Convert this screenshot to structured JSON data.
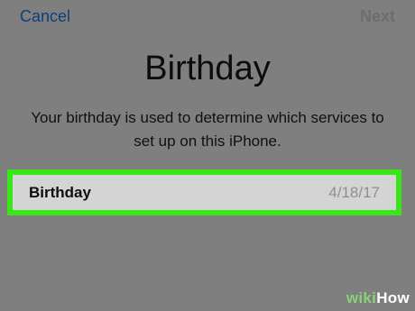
{
  "nav": {
    "cancel_label": "Cancel",
    "next_label": "Next"
  },
  "header": {
    "title": "Birthday",
    "subtitle": "Your birthday is used to determine which services to set up on this iPhone."
  },
  "birthday_field": {
    "label": "Birthday",
    "value": "4/18/17"
  },
  "watermark": {
    "part1": "wiki",
    "part2": "How"
  },
  "colors": {
    "background": "#7f7f7f",
    "accent_link": "#0e3f7a",
    "highlight_border": "#39e61a"
  }
}
